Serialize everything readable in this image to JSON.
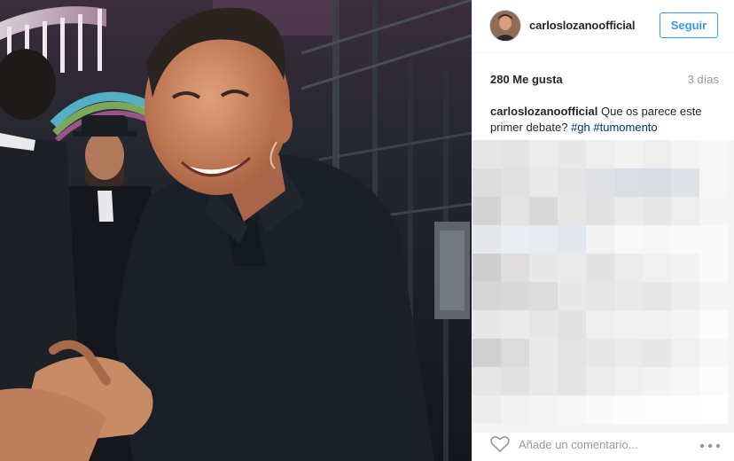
{
  "header": {
    "username": "carloslozanoofficial",
    "follow_label": "Seguir"
  },
  "stats": {
    "likes": "280 Me gusta",
    "time_ago": "3 días"
  },
  "caption": {
    "username": "carloslozanoofficial",
    "text": " Que os parece este primer debate? ",
    "hashtags": [
      "#gh",
      "#tumomento"
    ]
  },
  "comment": {
    "placeholder": "Añade un comentario..."
  },
  "icons": {
    "like": "heart-icon",
    "options": "more-options-icon"
  },
  "colors": {
    "follow_blue": "#3897f0",
    "hashtag": "#003569",
    "muted": "#999999"
  }
}
